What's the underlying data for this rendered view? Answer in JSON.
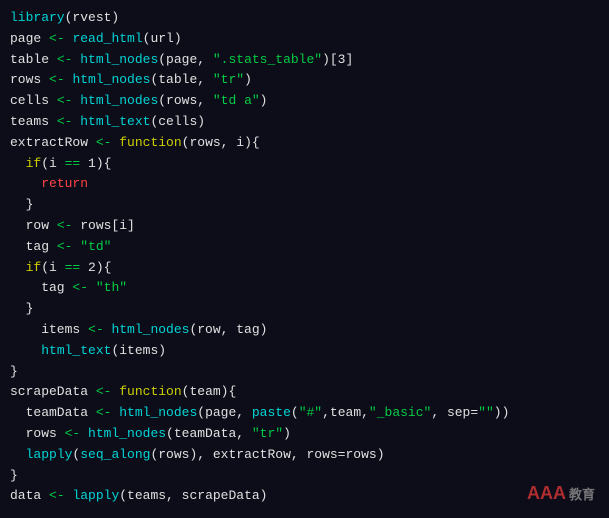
{
  "code": {
    "lines": [
      {
        "id": 1,
        "content": "library(rvest)"
      },
      {
        "id": 2,
        "content": "page <- read_html(url)"
      },
      {
        "id": 3,
        "content": "table <- html_nodes(page, \".stats_table\")[3]"
      },
      {
        "id": 4,
        "content": "rows <- html_nodes(table, \"tr\")"
      },
      {
        "id": 5,
        "content": "cells <- html_nodes(rows, \"td a\")"
      },
      {
        "id": 6,
        "content": "teams <- html_text(cells)"
      },
      {
        "id": 7,
        "content": "extractRow <- function(rows, i){"
      },
      {
        "id": 8,
        "content": "  if(i == 1){"
      },
      {
        "id": 9,
        "content": "    return"
      },
      {
        "id": 10,
        "content": "  }"
      },
      {
        "id": 11,
        "content": "  row <- rows[i]"
      },
      {
        "id": 12,
        "content": "  tag <- \"td\""
      },
      {
        "id": 13,
        "content": "  if(i == 2){"
      },
      {
        "id": 14,
        "content": "    tag <- \"th\""
      },
      {
        "id": 15,
        "content": "  }"
      },
      {
        "id": 16,
        "content": "    items <- html_nodes(row, tag)"
      },
      {
        "id": 17,
        "content": "    html_text(items)"
      },
      {
        "id": 18,
        "content": "}"
      },
      {
        "id": 19,
        "content": "scrapeData <- function(team){"
      },
      {
        "id": 20,
        "content": "  teamData <- html_nodes(page, paste(\"#\",team,\"_basic\", sep=\"\"))"
      },
      {
        "id": 21,
        "content": "  rows <- html_nodes(teamData, \"tr\")"
      },
      {
        "id": 22,
        "content": "  lapply(seq_along(rows), extractRow, rows=rows)"
      },
      {
        "id": 23,
        "content": "}"
      },
      {
        "id": 24,
        "content": "data <- lapply(teams, scrapeData)"
      }
    ]
  },
  "watermark": {
    "main": "AAA",
    "sub": "教育"
  }
}
